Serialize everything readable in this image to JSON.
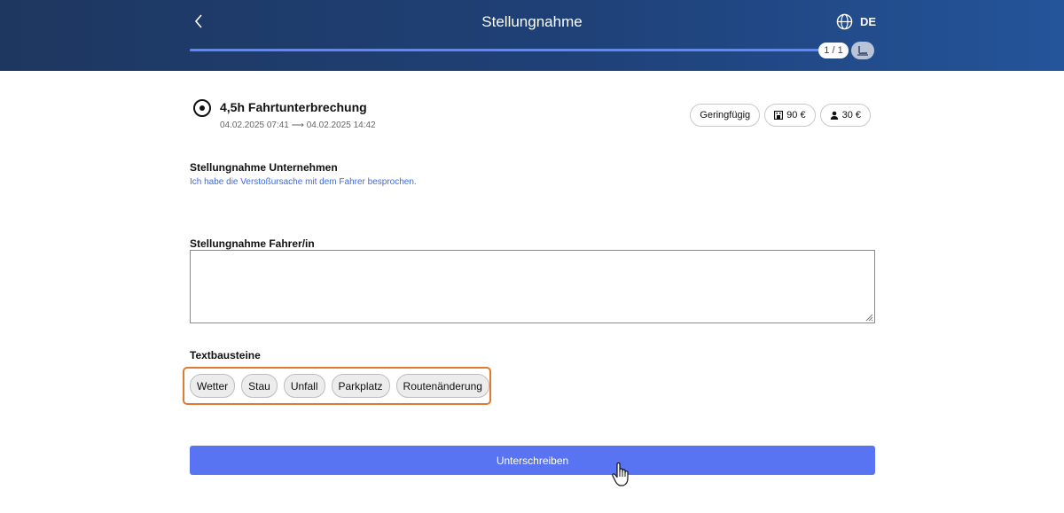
{
  "header": {
    "title": "Stellungnahme",
    "language": "DE",
    "progress_fraction": 1.0,
    "page_indicator": "1 / 1"
  },
  "violation": {
    "title": "4,5h Fahrtunterbrechung",
    "time_range": "04.02.2025 07:41 ⟶ 04.02.2025 14:42",
    "badges": {
      "severity": "Geringfügig",
      "company_fine": "90 €",
      "driver_fine": "30 €"
    }
  },
  "company_statement": {
    "label": "Stellungnahme Unternehmen",
    "text": "Ich habe die Verstoßursache mit dem Fahrer besprochen."
  },
  "driver_statement": {
    "label": "Stellungnahme Fahrer/in",
    "value": ""
  },
  "text_blocks": {
    "label": "Textbausteine",
    "items": [
      "Wetter",
      "Stau",
      "Unfall",
      "Parkplatz",
      "Routenänderung"
    ]
  },
  "actions": {
    "sign_label": "Unterschreiben"
  },
  "colors": {
    "header_start": "#1e3760",
    "header_end": "#24549a",
    "accent": "#5874f2",
    "link": "#3c6be0",
    "highlight": "#e07a2e"
  }
}
